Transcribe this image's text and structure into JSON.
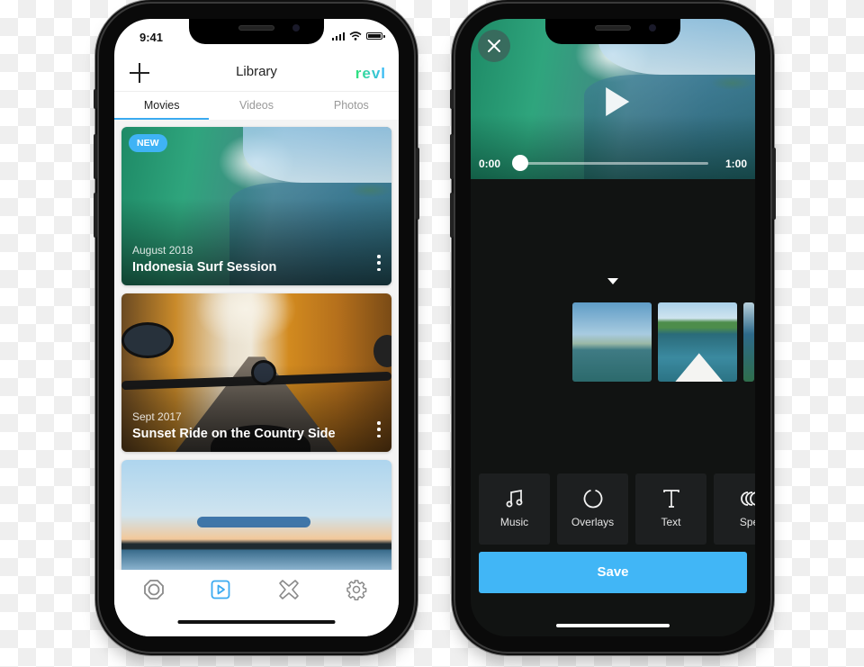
{
  "left_phone": {
    "status_bar": {
      "time": "9:41"
    },
    "header": {
      "title": "Library",
      "logo": "revl",
      "add_icon": "plus-icon"
    },
    "tabs": [
      {
        "label": "Movies",
        "active": true
      },
      {
        "label": "Videos",
        "active": false
      },
      {
        "label": "Photos",
        "active": false
      }
    ],
    "cards": [
      {
        "badge": "NEW",
        "date": "August 2018",
        "title": "Indonesia Surf Session",
        "image": "surf-wave"
      },
      {
        "date": "Sept 2017",
        "title": "Sunset Ride on the Country Side",
        "image": "motorcycle-road"
      },
      {
        "image": "kayak-lake-sunset"
      }
    ],
    "tabbar": [
      {
        "icon": "capture-icon",
        "active": false
      },
      {
        "icon": "play-library-icon",
        "active": true
      },
      {
        "icon": "tools-cross-icon",
        "active": false
      },
      {
        "icon": "settings-gear-icon",
        "active": false
      }
    ],
    "colors": {
      "accent": "#3aaaf0",
      "badge": "#3fb3f5",
      "logo_start": "#2fe27a",
      "logo_end": "#3bb8ff"
    }
  },
  "right_phone": {
    "player": {
      "current_time": "0:00",
      "duration": "1:00",
      "progress": 0.0,
      "close_icon": "close-icon",
      "play_icon": "play-icon"
    },
    "timeline": {
      "clips": [
        "surfers-in-water",
        "surfboard-nose-splash",
        "clip-partial"
      ]
    },
    "tools": [
      {
        "label": "Music",
        "icon": "music-note-icon"
      },
      {
        "label": "Overlays",
        "icon": "overlay-circle-icon"
      },
      {
        "label": "Text",
        "icon": "text-t-icon"
      },
      {
        "label": "Spe",
        "icon": "speed-icon"
      }
    ],
    "save_label": "Save",
    "colors": {
      "save_button": "#41b6f6",
      "background": "#111312",
      "tool_tile": "#1d1f20"
    }
  }
}
